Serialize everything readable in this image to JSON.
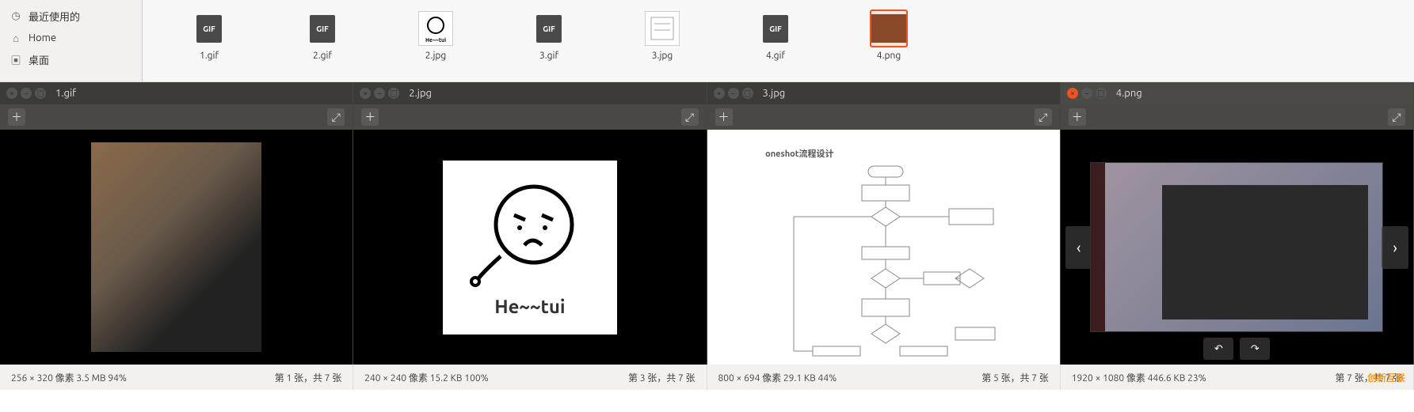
{
  "sidebar": {
    "items": [
      {
        "icon": "clock-icon",
        "label": "最近使用的"
      },
      {
        "icon": "home-icon",
        "label": "Home"
      },
      {
        "icon": "desktop-icon",
        "label": "桌面"
      }
    ]
  },
  "files": [
    {
      "name": "1.gif",
      "type": "gif",
      "selected": false
    },
    {
      "name": "2.gif",
      "type": "gif",
      "selected": false
    },
    {
      "name": "2.jpg",
      "type": "jpg",
      "content": "He~~tui",
      "selected": false
    },
    {
      "name": "3.gif",
      "type": "gif",
      "selected": false
    },
    {
      "name": "3.jpg",
      "type": "jpg",
      "selected": false
    },
    {
      "name": "4.gif",
      "type": "gif",
      "selected": false
    },
    {
      "name": "4.png",
      "type": "png",
      "selected": true
    }
  ],
  "viewers": [
    {
      "title": "1.gif",
      "active": false,
      "status_left": "256 × 320 像素  3.5 MB   94%",
      "status_right": "第 1 张，共 7 张"
    },
    {
      "title": "2.jpg",
      "active": false,
      "status_left": "240 × 240 像素  15.2 KB   100%",
      "status_right": "第 3 张，共 7 张",
      "caption": "He~~tui"
    },
    {
      "title": "3.jpg",
      "active": false,
      "status_left": "800 × 694 像素  29.1 KB   44%",
      "status_right": "第 5 张，共 7 张",
      "flow_title": "oneshot流程设计"
    },
    {
      "title": "4.png",
      "active": true,
      "status_left": "1920 × 1080 像素  446.6 KB   23%",
      "status_right": "第 7 张，共 7 张"
    }
  ],
  "watermark": "创新互联",
  "gif_badge": "GIF"
}
